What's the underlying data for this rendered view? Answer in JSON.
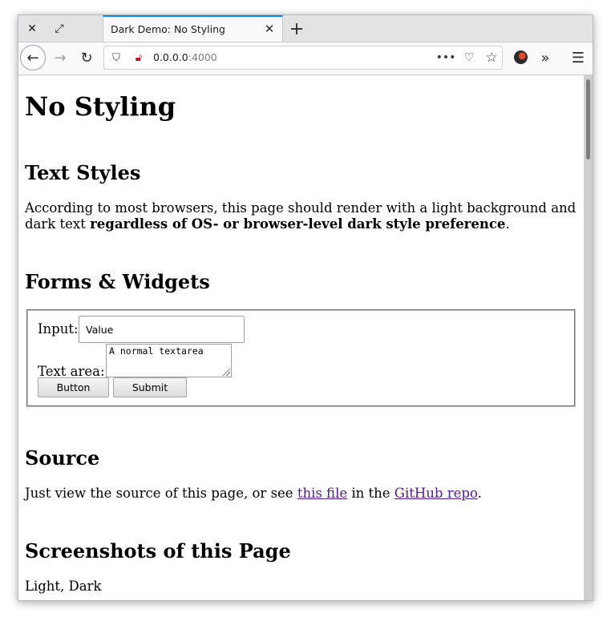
{
  "browser": {
    "tab_title": "Dark Demo: No Styling",
    "url_host": "0.0.0.0",
    "url_port": ":4000"
  },
  "page": {
    "title": "No Styling",
    "text_styles": {
      "heading": "Text Styles",
      "para_start": "According to most browsers, this page should render with a light background and dark text ",
      "para_bold": "regardless of OS- or browser-level dark style preference",
      "para_end": "."
    },
    "forms": {
      "heading": "Forms & Widgets",
      "input_label": "Input:",
      "input_value": "Value",
      "textarea_label": "Text area:",
      "textarea_value": "A normal textarea",
      "button_label": "Button",
      "submit_label": "Submit"
    },
    "source": {
      "heading": "Source",
      "text_start": "Just view the source of this page, or see ",
      "link1": "this file",
      "text_mid": " in the ",
      "link2": "GitHub repo",
      "text_end": "."
    },
    "screenshots": {
      "heading": "Screenshots of this Page",
      "text": "Light, Dark"
    }
  }
}
